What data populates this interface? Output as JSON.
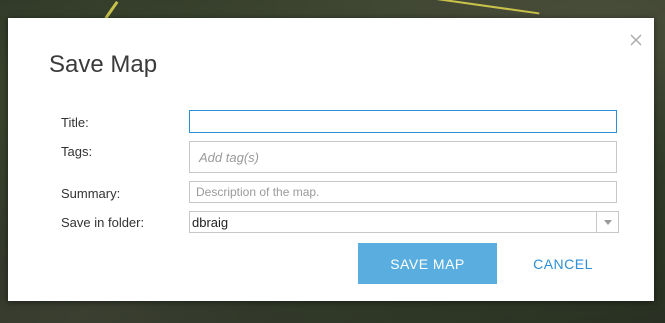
{
  "dialog": {
    "title": "Save Map",
    "close_icon": "close-icon"
  },
  "form": {
    "title_label": "Title:",
    "title_value": "",
    "tags_label": "Tags:",
    "tags_placeholder": "Add tag(s)",
    "summary_label": "Summary:",
    "summary_placeholder": "Description of the map.",
    "folder_label": "Save in folder:",
    "folder_value": "dbraig",
    "folder_arrow_icon": "chevron-down-icon"
  },
  "actions": {
    "save_label": "SAVE MAP",
    "cancel_label": "CANCEL"
  },
  "colors": {
    "accent": "#2d8fd5",
    "save_button": "#5aaedf"
  }
}
